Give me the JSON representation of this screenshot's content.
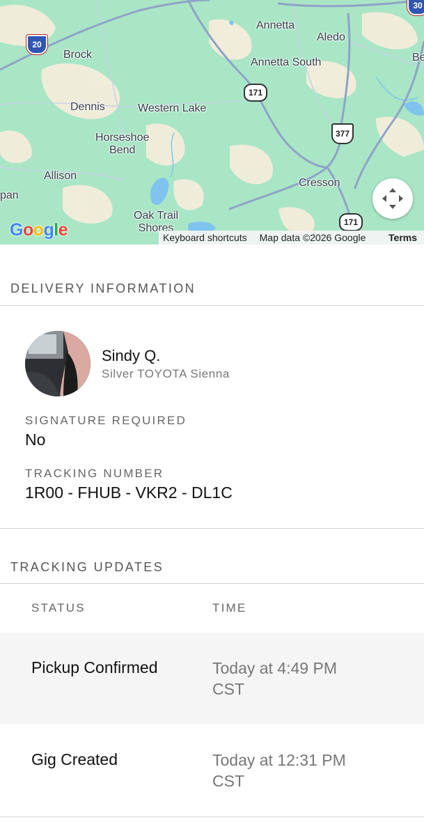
{
  "map": {
    "places": [
      "Brock",
      "Annetta",
      "Aledo",
      "Annetta South",
      "Dennis",
      "Western Lake",
      "Horseshoe\nBend",
      "Allison",
      "Cresson",
      "Oak Trail\nShores",
      "pan",
      "Be"
    ],
    "routes": {
      "i20": "20",
      "sr171_top": "171",
      "us377": "377",
      "sr171_bottom": "171",
      "i30": "30"
    },
    "logo": "Google",
    "attribution": {
      "shortcuts": "Keyboard shortcuts",
      "data": "Map data ©2026 Google",
      "terms": "Terms"
    },
    "recenter_icon": "recenter-arrows-icon"
  },
  "delivery": {
    "section_title": "DELIVERY INFORMATION",
    "driver": {
      "name": "Sindy Q.",
      "vehicle": "Silver TOYOTA Sienna"
    },
    "signature_label": "SIGNATURE REQUIRED",
    "signature_value": "No",
    "tracking_label": "TRACKING NUMBER",
    "tracking_value": "1R00 - FHUB - VKR2 - DL1C"
  },
  "tracking": {
    "section_title": "TRACKING UPDATES",
    "headers": {
      "status": "STATUS",
      "time": "TIME"
    },
    "rows": [
      {
        "status": "Pickup Confirmed",
        "time_line1": "Today at 4:49 PM",
        "time_line2": "CST"
      },
      {
        "status": "Gig Created",
        "time_line1": "Today at 12:31 PM",
        "time_line2": "CST"
      }
    ]
  },
  "colors": {
    "map_green": "#a9e6c6",
    "road": "#8fa3c7",
    "divider": "#d4d4d4",
    "shaded_row": "#f5f5f5"
  }
}
